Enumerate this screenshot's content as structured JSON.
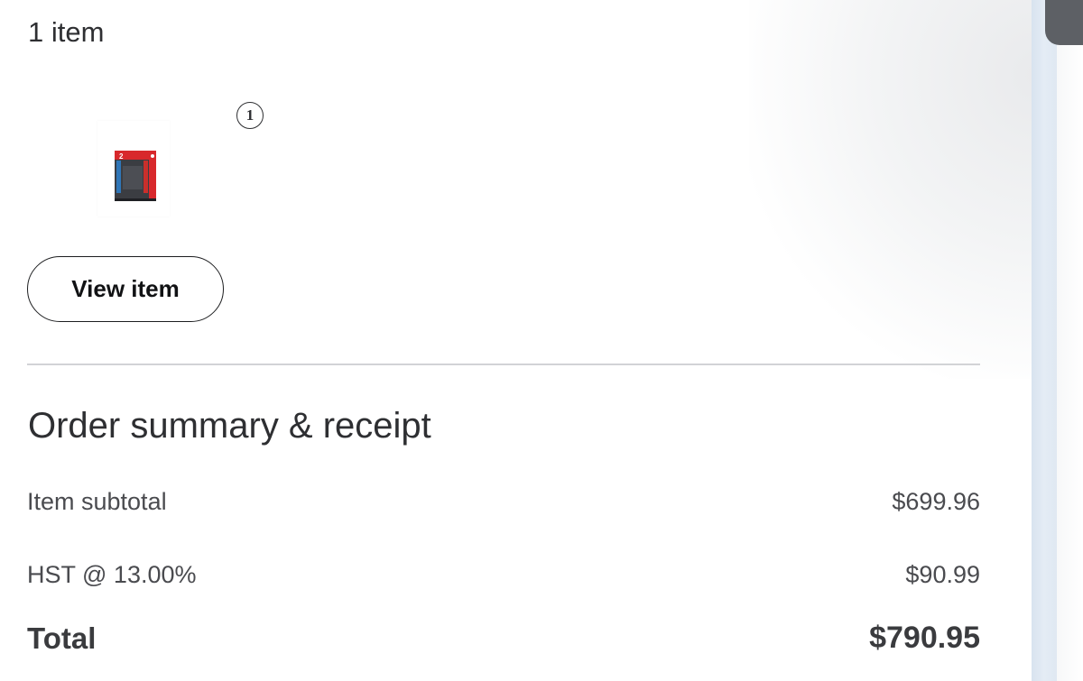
{
  "order": {
    "item_count_label": "1 item",
    "items": [
      {
        "quantity": "1",
        "product_icon": "game-console-box-icon"
      }
    ],
    "view_item_label": "View item"
  },
  "summary": {
    "title": "Order summary & receipt",
    "lines": [
      {
        "label": "Item subtotal",
        "amount": "$699.96"
      },
      {
        "label": "HST @ 13.00%",
        "amount": "$90.99"
      }
    ],
    "total": {
      "label": "Total",
      "amount": "$790.95"
    }
  },
  "colors": {
    "text": "#2e2f32",
    "muted_text": "#4a4b4f",
    "divider": "#d2d3d6",
    "product_box_red": "#d8282c",
    "edge_tint": "#dde7f1"
  }
}
